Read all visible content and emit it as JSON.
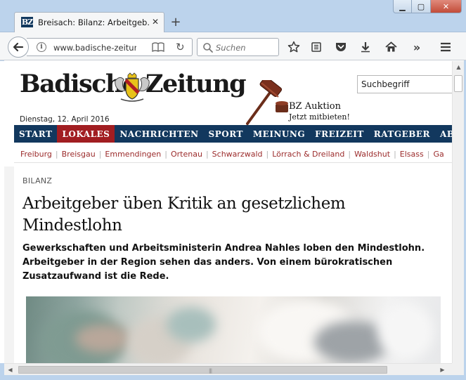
{
  "browser": {
    "tab_favicon": "BZ",
    "tab_title": "Breisach: Bilanz: Arbeitgeb...",
    "url": "www.badische-zeitung",
    "search_placeholder": "Suchen",
    "icons": [
      "back-icon",
      "info-icon",
      "reader-view-icon",
      "reload-icon",
      "search-icon",
      "bookmark-star-icon",
      "reading-list-icon",
      "pocket-icon",
      "download-icon",
      "home-icon",
      "overflow-icon",
      "menu-icon"
    ]
  },
  "site": {
    "logo_left": "Badische",
    "logo_right": "Zeitung",
    "date": "Dienstag, 12. April 2016",
    "search_placeholder": "Suchbegriff",
    "auction_title": "BZ Auktion",
    "auction_sub": "Jetzt mitbieten!",
    "main_nav": [
      {
        "label": "START"
      },
      {
        "label": "LOKALES",
        "active": true
      },
      {
        "label": "NACHRICHTEN"
      },
      {
        "label": "SPORT"
      },
      {
        "label": "MEINUNG"
      },
      {
        "label": "FREIZEIT"
      },
      {
        "label": "RATGEBER"
      },
      {
        "label": "ABO"
      }
    ],
    "sub_nav": [
      "Freiburg",
      "Breisgau",
      "Emmendingen",
      "Ortenau",
      "Schwarzwald",
      "Lörrach & Dreiland",
      "Waldshut",
      "Elsass",
      "Ga"
    ],
    "colors": {
      "nav_bg": "#12385e",
      "nav_active": "#a11d21",
      "subnav_link": "#9b2b2b"
    }
  },
  "article": {
    "kicker": "BILANZ",
    "headline": "Arbeitgeber üben Kritik an gesetzlichem Mindestlohn",
    "lead": "Gewerkschaften und Arbeitsministerin Andrea Nahles loben den Mindestlohn. Arbeitgeber in der Region sehen das anders. Von einem bürokratischen Zusatzaufwand ist die Rede."
  }
}
